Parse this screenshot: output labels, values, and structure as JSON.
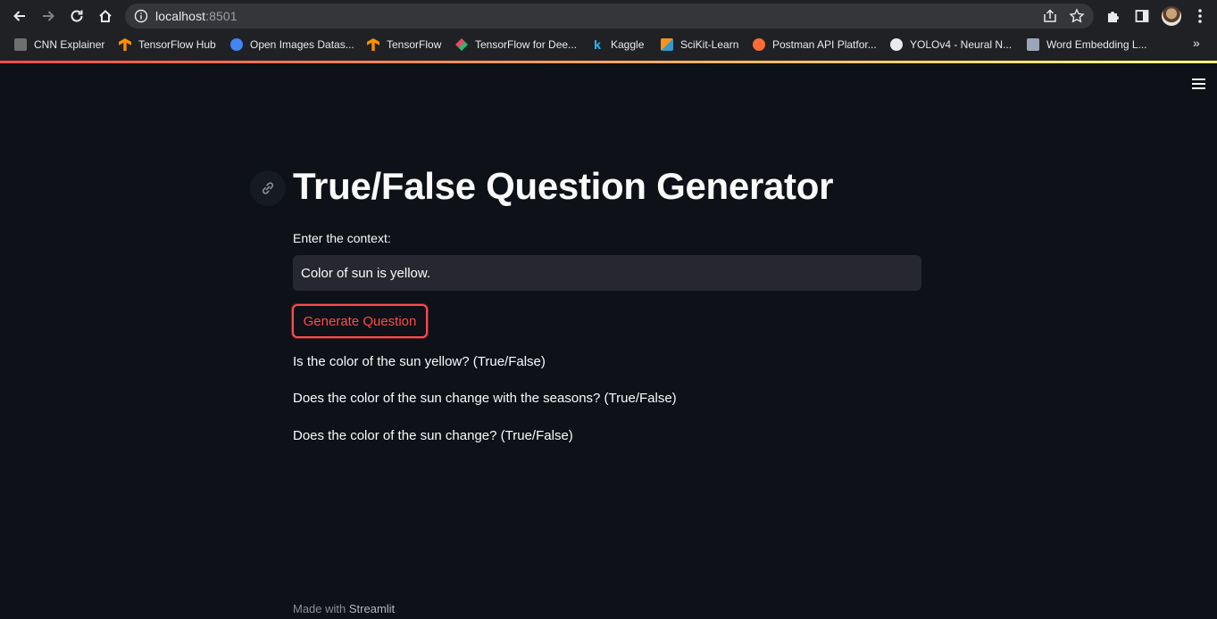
{
  "browser": {
    "url_host": "localhost",
    "url_port": ":8501",
    "bookmarks": [
      {
        "label": "CNN Explainer",
        "icon": "cnn-explainer-icon",
        "color": "#8a8a8a"
      },
      {
        "label": "TensorFlow Hub",
        "icon": "tensorflow-icon",
        "color": "#ff8f00"
      },
      {
        "label": "Open Images Datas...",
        "icon": "google-icon",
        "color": "#4285f4"
      },
      {
        "label": "TensorFlow",
        "icon": "tensorflow-icon",
        "color": "#ff8f00"
      },
      {
        "label": "TensorFlow for Dee...",
        "icon": "layers-icon",
        "color": "#e64a5f"
      },
      {
        "label": "Kaggle",
        "icon": "kaggle-icon",
        "color": "#20beff"
      },
      {
        "label": "SciKit-Learn",
        "icon": "scikit-learn-icon",
        "color": "#f7931e"
      },
      {
        "label": "Postman API Platfor...",
        "icon": "postman-icon",
        "color": "#ff6c37"
      },
      {
        "label": "YOLOv4 - Neural N...",
        "icon": "github-icon",
        "color": "#e8eaed"
      },
      {
        "label": "Word Embedding L...",
        "icon": "image-icon",
        "color": "#9aa6b8"
      }
    ]
  },
  "app": {
    "title": "True/False Question Generator",
    "input_label": "Enter the context:",
    "input_value": "Color of sun is yellow.",
    "button_label": "Generate Question",
    "questions": [
      "Is the color of the sun yellow? (True/False)",
      "Does the color of the sun change with the seasons? (True/False)",
      "Does the color of the sun change? (True/False)"
    ],
    "footer_prefix": "Made with",
    "footer_brand": "Streamlit"
  },
  "colors": {
    "background": "#0e1117",
    "accent": "#ff4b4b",
    "input_bg": "#262730",
    "text": "#fafafa"
  }
}
